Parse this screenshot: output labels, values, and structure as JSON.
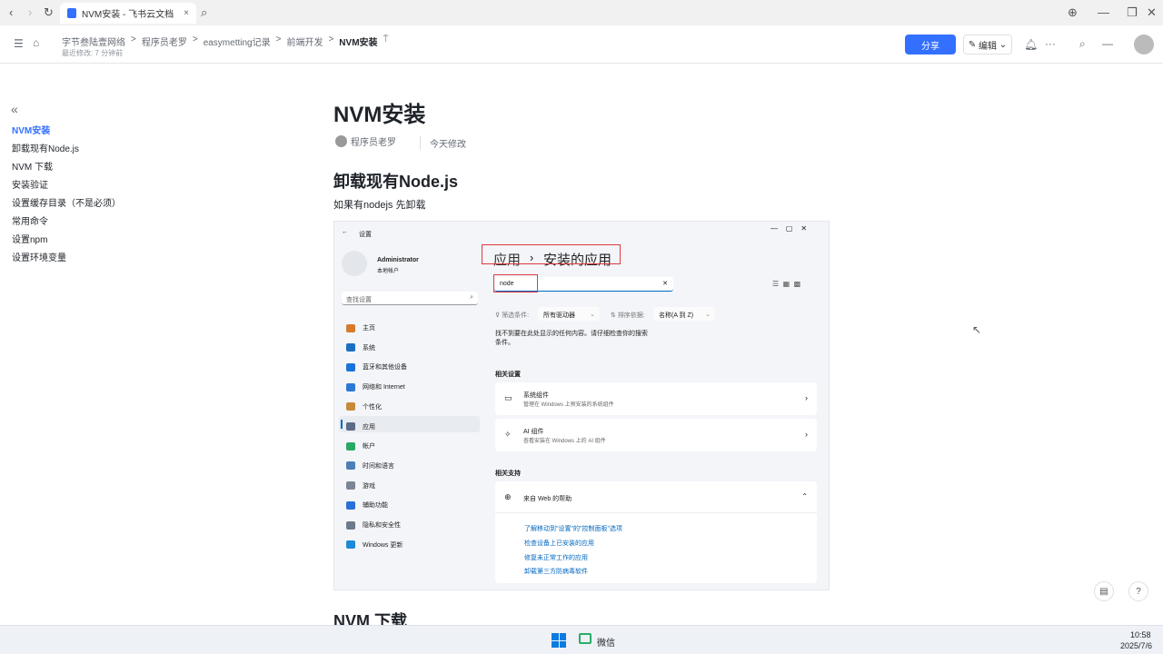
{
  "browser": {
    "tab_title": "NVM安装 - 飞书云文档",
    "close": "×",
    "back": "‹",
    "forward": "›",
    "reload": "↻",
    "search": "⌕",
    "globe": "⊕",
    "minimize": "—",
    "restore": "❐",
    "close_window": "✕"
  },
  "header": {
    "breadcrumbs": [
      "字节叁陆壹网络",
      "程序员老罗",
      "easymetting记录",
      "前端开发",
      "NVM安装"
    ],
    "last_modified": "最近修改: 7 分钟前",
    "share": "分享",
    "edit": "编辑",
    "sep": ">"
  },
  "toc": {
    "collapse": "«",
    "items": [
      "NVM安装",
      "卸载现有Node.js",
      "NVM 下载",
      "安装验证",
      "设置缓存目录（不是必须）",
      "常用命令",
      "设置npm",
      "设置环境变量"
    ]
  },
  "doc": {
    "title": "NVM安装",
    "author": "程序员老罗",
    "modified": "今天修改",
    "h2_1": "卸载现有Node.js",
    "para1": "如果有nodejs 先卸载",
    "h2_2": "NVM 下载"
  },
  "settings": {
    "title": "设置",
    "user": "Administrator",
    "account_type": "本地帐户",
    "search_placeholder": "查找设置",
    "nav": [
      "主页",
      "系统",
      "蓝牙和其他设备",
      "网络和 Internet",
      "个性化",
      "应用",
      "帐户",
      "时间和语言",
      "游戏",
      "辅助功能",
      "隐私和安全性",
      "Windows 更新"
    ],
    "breadcrumb_parent": "应用",
    "breadcrumb_current": "安装的应用",
    "search_value": "node",
    "filter_label": "筛选条件:",
    "filter_value": "所有驱动器",
    "sort_label": "排序依据:",
    "sort_value": "名称(A 到 Z)",
    "empty_msg": "找不到要在此处显示的任何内容。请仔细检查你的搜索条件。",
    "related_settings": "相关设置",
    "cards": [
      {
        "title": "系统组件",
        "desc": "管理在 Windows 上预安装的系统组件"
      },
      {
        "title": "AI 组件",
        "desc": "查看安装在 Windows 上的 AI 组件"
      }
    ],
    "related_support": "相关支持",
    "web_help": "来自 Web 的帮助",
    "links": [
      "了解移动到\"设置\"的\"控制面板\"选项",
      "检查设备上已安装的应用",
      "修复未正常工作的应用",
      "卸载第三方防病毒软件"
    ]
  },
  "taskbar": {
    "app": "微信",
    "time": "10:58",
    "date": "2025/7/6"
  },
  "colors": {
    "accent": "#3370ff",
    "highlight": "#e0393e"
  }
}
